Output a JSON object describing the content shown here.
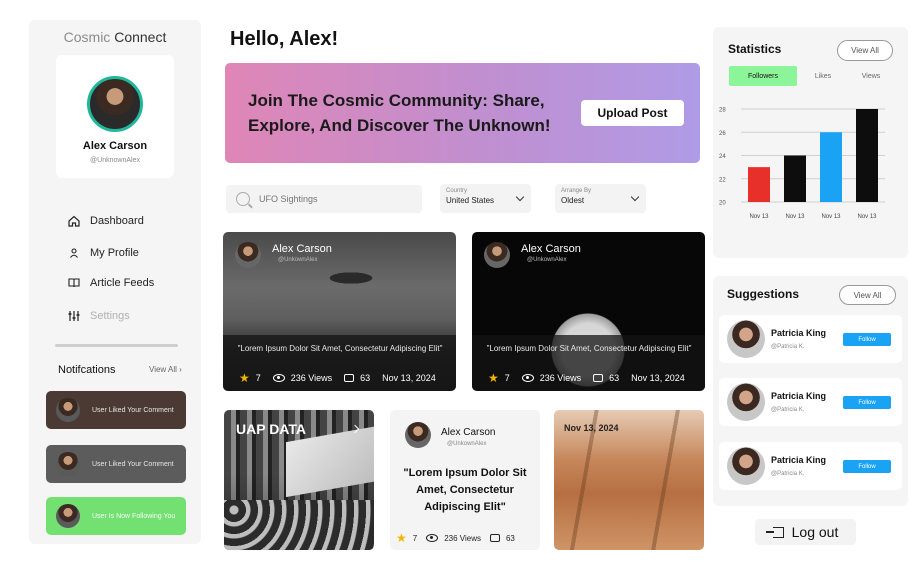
{
  "brand": {
    "part1": "Cosmic",
    "part2": "Connect"
  },
  "profile": {
    "name": "Alex Carson",
    "handle": "@UnknownAlex"
  },
  "nav": [
    {
      "label": "Dashboard",
      "icon": "home-icon"
    },
    {
      "label": "My Profile",
      "icon": "user-icon"
    },
    {
      "label": "Article Feeds",
      "icon": "book-icon"
    },
    {
      "label": "Settings",
      "icon": "sliders-icon"
    }
  ],
  "notifications": {
    "title": "Notifcations",
    "view_all": "View All ›",
    "items": [
      {
        "text": "User Liked Your Comment",
        "color": "#4a3a33"
      },
      {
        "text": "User Liked Your Comment",
        "color": "#5c5c5c"
      },
      {
        "text": "User Is Now Following You",
        "color": "#73e072"
      }
    ]
  },
  "greeting": "Hello, Alex!",
  "banner": {
    "text": "Join The Cosmic Community: Share, Explore, And Discover The Unknown!",
    "button": "Upload Post"
  },
  "filters": {
    "search_placeholder": "UFO Sightings",
    "country_label": "Country",
    "country_value": "United States",
    "arrange_label": "Arrange By",
    "arrange_value": "Oldest"
  },
  "posts": [
    {
      "name": "Alex Carson",
      "handle": "@UnkownAlex",
      "quote": "\"Lorem Ipsum Dolor Sit Amet, Consectetur Adipiscing Elit\"",
      "stars": "7",
      "views": "236 Views",
      "comments": "63",
      "date": "Nov 13, 2024"
    },
    {
      "name": "Alex Carson",
      "handle": "@UnkownAlex",
      "quote": "\"Lorem Ipsum Dolor Sit Amet, Consectetur Adipiscing Elit\"",
      "stars": "7",
      "views": "236 Views",
      "comments": "63",
      "date": "Nov 13, 2024"
    }
  ],
  "uap": {
    "title": "UAP DATA"
  },
  "text_post": {
    "name": "Alex Carson",
    "handle": "@UnkownAlex",
    "quote": "\"Lorem Ipsum Dolor Sit Amet, Consectetur Adipiscing Elit\"",
    "stars": "7",
    "views": "236 Views",
    "comments": "63"
  },
  "mars": {
    "date": "Nov 13, 2024"
  },
  "statistics": {
    "title": "Statistics",
    "view_all": "View All",
    "tabs": [
      "Followers",
      "Likes",
      "Views"
    ],
    "accent": "#8cf59a"
  },
  "chart_data": {
    "type": "bar",
    "categories": [
      "Nov 13",
      "Nov 13",
      "Nov 13",
      "Nov 13"
    ],
    "values": [
      23,
      24,
      26,
      28
    ],
    "colors": [
      "#e8302b",
      "#0d0d0d",
      "#1aa3f5",
      "#0d0d0d"
    ],
    "ylim": [
      20,
      28
    ],
    "yticks": [
      20,
      22,
      24,
      26,
      28
    ],
    "grid": true
  },
  "suggestions": {
    "title": "Suggestions",
    "view_all": "View All",
    "items": [
      {
        "name": "Patricia King",
        "handle": "@Patricia K.",
        "button": "Follow"
      },
      {
        "name": "Patricia King",
        "handle": "@Patricia K.",
        "button": "Follow"
      },
      {
        "name": "Patricia King",
        "handle": "@Patricia K.",
        "button": "Follow"
      }
    ],
    "button_color": "#1aa3f5"
  },
  "logout": "Log out"
}
